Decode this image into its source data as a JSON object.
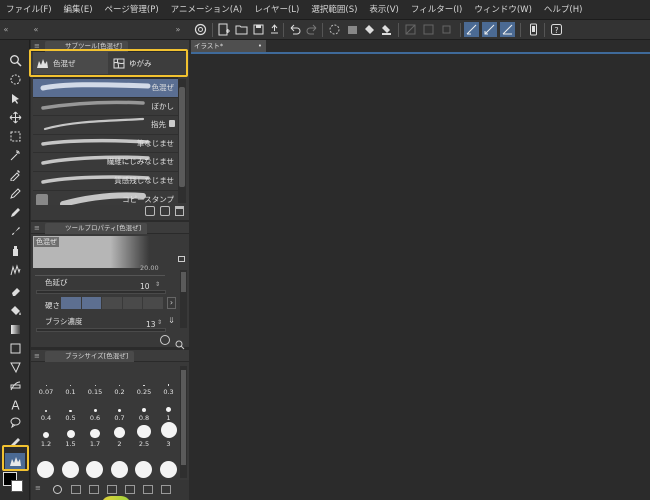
{
  "menu": [
    "ファイル(F)",
    "編集(E)",
    "ページ管理(P)",
    "アニメーション(A)",
    "レイヤー(L)",
    "選択範囲(S)",
    "表示(V)",
    "フィルター(I)",
    "ウィンドウ(W)",
    "ヘルプ(H)"
  ],
  "colors": {
    "highlight": "#f2c230",
    "accent": "#3f6a9a",
    "active_tool": "#4b6a93"
  },
  "subtool_panel": {
    "title": "サブツール[色混ぜ]",
    "tabs": [
      "色混ぜ",
      "ゆがみ"
    ],
    "brushes": [
      {
        "name": "色混ぜ",
        "selected": true
      },
      {
        "name": "ぼかし"
      },
      {
        "name": "指先",
        "locked": true
      },
      {
        "name": "筆なじませ"
      },
      {
        "name": "繊維にじみなじませ"
      },
      {
        "name": "質感残しなじませ"
      },
      {
        "name": "コピースタンプ"
      }
    ]
  },
  "tool_property": {
    "title": "ツールプロパティ[色混ぜ]",
    "preview_label": "色混ぜ",
    "size_partial": "20.00",
    "rows": [
      {
        "label": "色延び",
        "value": "10"
      },
      {
        "label": "硬さ",
        "value": ""
      },
      {
        "label": "ブラシ濃度",
        "value": "13"
      }
    ]
  },
  "brush_size": {
    "title": "ブラシサイズ[色混ぜ]",
    "sizes": [
      "0.07",
      "0.1",
      "0.15",
      "0.2",
      "0.25",
      "0.3",
      "0.4",
      "0.5",
      "0.6",
      "0.7",
      "0.8",
      "1",
      "1.2",
      "1.5",
      "1.7",
      "2",
      "2.5",
      "3"
    ]
  },
  "document": {
    "tab": "イラスト*"
  }
}
